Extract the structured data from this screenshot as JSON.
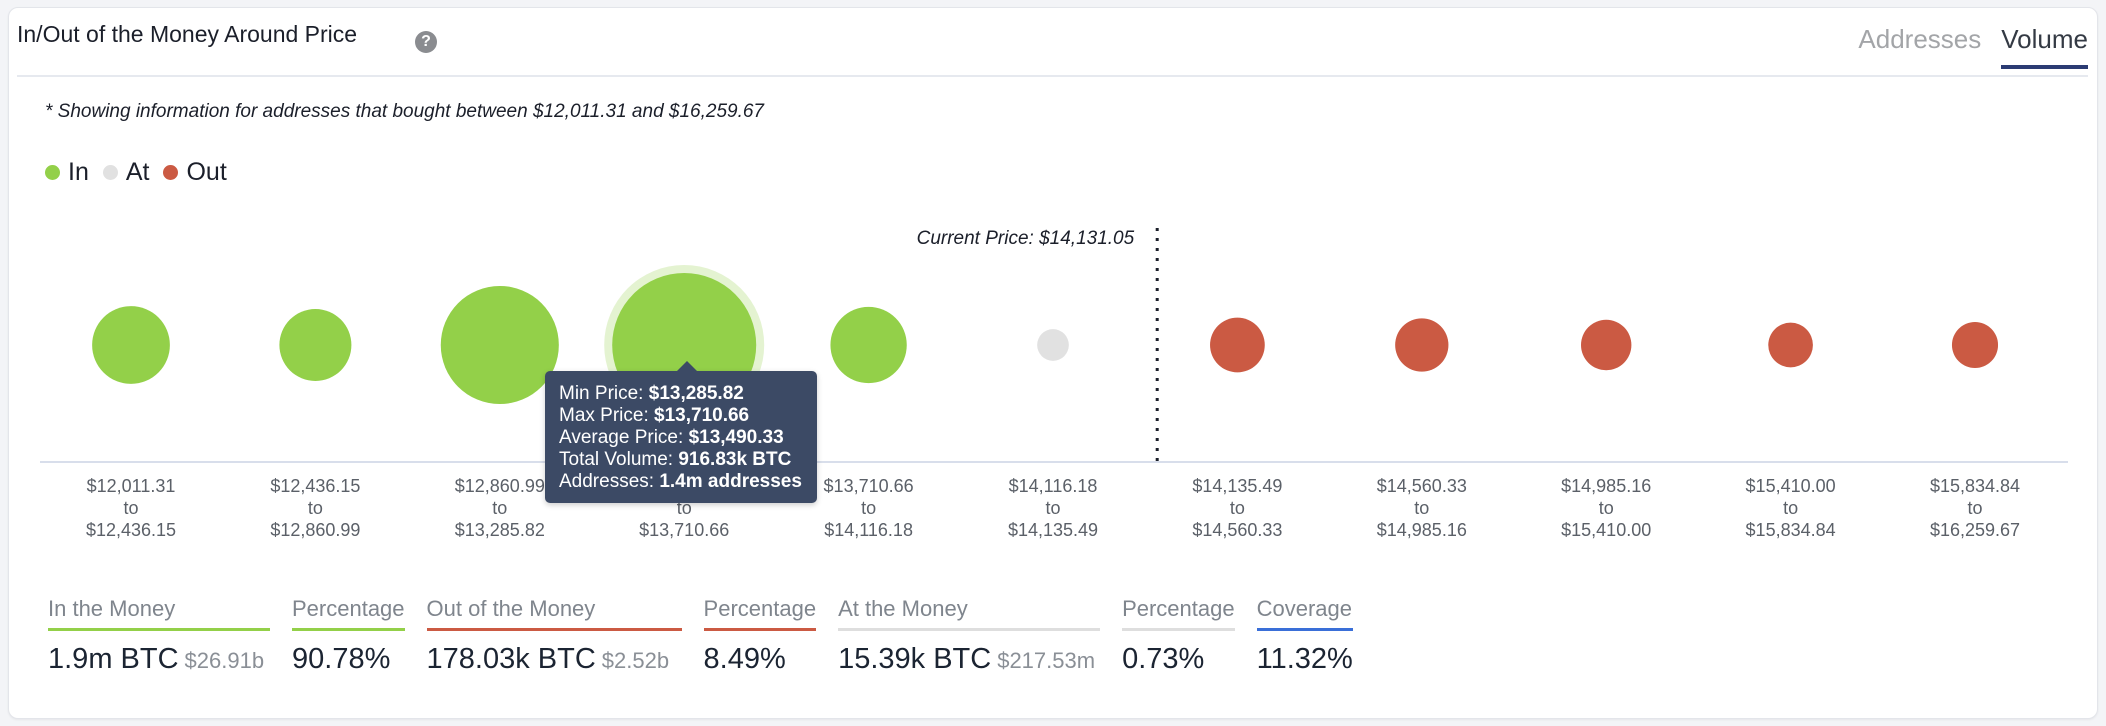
{
  "header": {
    "title": "In/Out of the Money Around Price",
    "help_icon": "question-circle-icon",
    "tabs": [
      {
        "label": "Addresses",
        "active": false
      },
      {
        "label": "Volume",
        "active": true
      }
    ]
  },
  "note": "* Showing information for addresses that bought between $12,011.31 and $16,259.67",
  "legend": [
    {
      "label": "In",
      "color": "#93d049"
    },
    {
      "label": "At",
      "color": "#e1e1e1"
    },
    {
      "label": "Out",
      "color": "#cb5a43"
    }
  ],
  "current_price_label": "Current Price: $14,131.05",
  "tooltip": {
    "rows": [
      {
        "label": "Min Price: ",
        "value": "$13,285.82"
      },
      {
        "label": "Max Price: ",
        "value": "$13,710.66"
      },
      {
        "label": "Average Price: ",
        "value": "$13,490.33"
      },
      {
        "label": "Total Volume: ",
        "value": "916.83k BTC"
      },
      {
        "label": "Addresses: ",
        "value": "1.4m addresses"
      }
    ]
  },
  "chart_data": {
    "type": "scatter",
    "subtype": "bubble",
    "title": "In/Out of the Money Around Price",
    "metric": "Volume",
    "current_price": 14131.05,
    "current_price_between_buckets": [
      5,
      6
    ],
    "categories": [
      {
        "from": "$12,011.31",
        "to": "$12,436.15",
        "status": "In",
        "relative_size": 0.54
      },
      {
        "from": "$12,436.15",
        "to": "$12,860.99",
        "status": "In",
        "relative_size": 0.5
      },
      {
        "from": "$12,860.99",
        "to": "$13,285.82",
        "status": "In",
        "relative_size": 0.82
      },
      {
        "from": "$13,285.82",
        "to": "$13,710.66",
        "status": "In",
        "relative_size": 1.0,
        "volume": "916.83k BTC",
        "addresses": "1.4m addresses",
        "avg_price": "$13,490.33",
        "highlighted": true
      },
      {
        "from": "$13,710.66",
        "to": "$14,116.18",
        "status": "In",
        "relative_size": 0.53
      },
      {
        "from": "$14,116.18",
        "to": "$14,135.49",
        "status": "At",
        "relative_size": 0.22
      },
      {
        "from": "$14,135.49",
        "to": "$14,560.33",
        "status": "Out",
        "relative_size": 0.38
      },
      {
        "from": "$14,560.33",
        "to": "$14,985.16",
        "status": "Out",
        "relative_size": 0.37
      },
      {
        "from": "$14,985.16",
        "to": "$15,410.00",
        "status": "Out",
        "relative_size": 0.35
      },
      {
        "from": "$15,410.00",
        "to": "$15,834.84",
        "status": "Out",
        "relative_size": 0.31
      },
      {
        "from": "$15,834.84",
        "to": "$16,259.67",
        "status": "Out",
        "relative_size": 0.32
      }
    ],
    "connector_word": "to",
    "legend": [
      "In",
      "At",
      "Out"
    ],
    "legend_position": "top-left",
    "colors": {
      "In": "#93d049",
      "At": "#e1e1e1",
      "Out": "#cb5a43"
    }
  },
  "stats": [
    {
      "label": "In the Money",
      "value": "1.9m BTC",
      "sub": "$26.91b",
      "color": "#93d049"
    },
    {
      "label": "Percentage",
      "value": "90.78%",
      "sub": "",
      "color": "#93d049"
    },
    {
      "label": "Out of the Money",
      "value": "178.03k BTC",
      "sub": "$2.52b",
      "color": "#cb5a43"
    },
    {
      "label": "Percentage",
      "value": "8.49%",
      "sub": "",
      "color": "#cb5a43"
    },
    {
      "label": "At the Money",
      "value": "15.39k BTC",
      "sub": "$217.53m",
      "color": "#dedede"
    },
    {
      "label": "Percentage",
      "value": "0.73%",
      "sub": "",
      "color": "#dedede"
    },
    {
      "label": "Coverage",
      "value": "11.32%",
      "sub": "",
      "color": "#3a6fd8"
    }
  ]
}
